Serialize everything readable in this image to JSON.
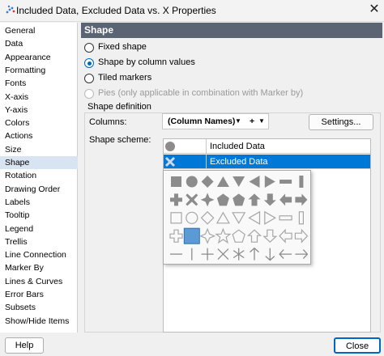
{
  "window": {
    "title": "Included Data, Excluded Data vs. X Properties",
    "close_glyph": "✕"
  },
  "nav": {
    "selected": "Shape",
    "items": [
      "General",
      "Data",
      "Appearance",
      "Formatting",
      "Fonts",
      "X-axis",
      "Y-axis",
      "Colors",
      "Actions",
      "Size",
      "Shape",
      "Rotation",
      "Drawing Order",
      "Labels",
      "Tooltip",
      "Legend",
      "Trellis",
      "Line Connection",
      "Marker By",
      "Lines & Curves",
      "Error Bars",
      "Subsets",
      "Show/Hide Items"
    ]
  },
  "panel": {
    "header": "Shape",
    "options": [
      {
        "label": "Fixed shape",
        "selected": false,
        "disabled": false
      },
      {
        "label": "Shape by column values",
        "selected": true,
        "disabled": false
      },
      {
        "label": "Tiled markers",
        "selected": false,
        "disabled": false
      },
      {
        "label": "Pies (only applicable in combination with Marker by)",
        "selected": false,
        "disabled": true
      }
    ],
    "group_title": "Shape definition",
    "columns_label": "Columns:",
    "columns_value": "(Column Names)",
    "columns_modifier": "+",
    "settings_button": "Settings...",
    "scheme_label": "Shape scheme:",
    "scheme_rows": [
      {
        "label": "Included Data",
        "shape": "circle-filled",
        "selected": false
      },
      {
        "label": "Excluded Data",
        "shape": "x-outline",
        "selected": true
      }
    ],
    "palette_selected": "square-filled"
  },
  "colors": {
    "accent": "#0078d7",
    "header": "#5b6473",
    "shape_gray": "#8c8c8c",
    "shape_outline": "#a6a6a6",
    "palette_selected_fill": "#5b9bd5"
  },
  "buttons": {
    "help": "Help",
    "close": "Close"
  }
}
